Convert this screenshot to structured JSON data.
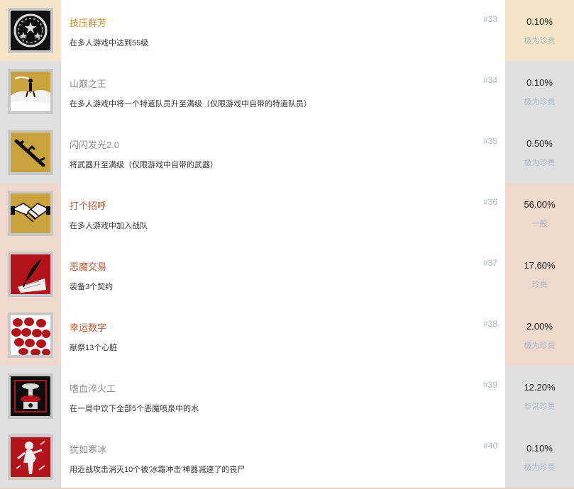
{
  "colors": {
    "gold_bg": "#f6e4c6",
    "gray_bg": "#e0e0e0",
    "rose_bg": "#efd8cd",
    "gold_title": "#c98d2c",
    "gray_title": "#8b8b8b",
    "red_title": "#b4572f"
  },
  "trophies": [
    {
      "icon": "laurel-wreath-icon",
      "title": "技压群芳",
      "desc": "在多人游戏中达到55级",
      "num": "#33",
      "percent": "0.10%",
      "rarity": "极为珍贵",
      "tier": "gold"
    },
    {
      "icon": "hill-silhouette-icon",
      "title": "山巅之王",
      "desc": "在多人游戏中将一个特遣队员升至满级（仅限游戏中自带的特遣队员）",
      "num": "#34",
      "percent": "0.10%",
      "rarity": "极为珍贵",
      "tier": "gray"
    },
    {
      "icon": "rifle-icon",
      "title": "闪闪发光2.0",
      "desc": "将武器升至满级（仅限游戏中自带的武器）",
      "num": "#35",
      "percent": "0.50%",
      "rarity": "极为珍贵",
      "tier": "gray"
    },
    {
      "icon": "handshake-icon",
      "title": "打个招呼",
      "desc": "在多人游戏中加入战队",
      "num": "#36",
      "percent": "56.00%",
      "rarity": "一般",
      "tier": "red"
    },
    {
      "icon": "quill-contract-icon",
      "title": "恶魔交易",
      "desc": "装备3个契约",
      "num": "#37",
      "percent": "17.60%",
      "rarity": "珍贵",
      "tier": "red"
    },
    {
      "icon": "hearts-icon",
      "title": "幸运数字",
      "desc": "献祭13个心脏",
      "num": "#38",
      "percent": "2.00%",
      "rarity": "极为珍贵",
      "tier": "red"
    },
    {
      "icon": "fountain-icon",
      "title": "嗜血淬火工",
      "desc": "在一局中饮下全部5个恶魔喷泉中的水",
      "num": "#39",
      "percent": "12.20%",
      "rarity": "非常珍贵",
      "tier": "gray"
    },
    {
      "icon": "frozen-zombie-icon",
      "title": "犹如寒冰",
      "desc": "用近战攻击消灭10个被'冰霜冲击'神器减速了的丧尸",
      "num": "#40",
      "percent": "0.10%",
      "rarity": "极为珍贵",
      "tier": "gray"
    }
  ]
}
